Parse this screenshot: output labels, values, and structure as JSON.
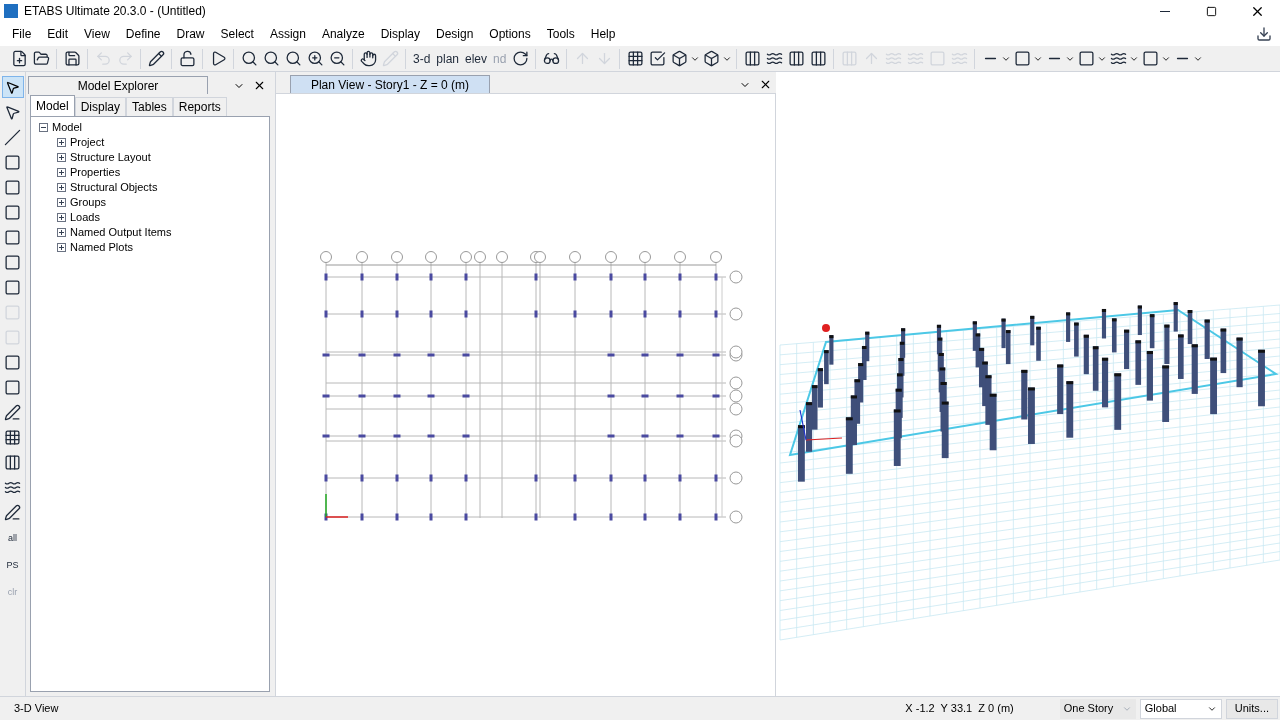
{
  "window": {
    "title": "ETABS Ultimate 20.3.0 - (Untitled)"
  },
  "menu": [
    "File",
    "Edit",
    "View",
    "Define",
    "Draw",
    "Select",
    "Assign",
    "Analyze",
    "Display",
    "Design",
    "Options",
    "Tools",
    "Help"
  ],
  "toolbar": {
    "text_buttons": [
      {
        "label": "3-d",
        "disabled": false
      },
      {
        "label": "plan",
        "disabled": false
      },
      {
        "label": "elev",
        "disabled": false
      },
      {
        "label": "nd",
        "disabled": true
      }
    ]
  },
  "left_tools": [
    {
      "label": "all",
      "disabled": false
    },
    {
      "label": "PS",
      "disabled": false
    },
    {
      "label": "clr",
      "disabled": true
    }
  ],
  "explorer": {
    "title": "Model Explorer",
    "tabs": [
      {
        "label": "Model",
        "selected": true
      },
      {
        "label": "Display",
        "selected": false
      },
      {
        "label": "Tables",
        "selected": false
      },
      {
        "label": "Reports",
        "selected": false
      }
    ],
    "tree": {
      "label": "Model",
      "expanded": true,
      "children": [
        {
          "label": "Project",
          "expanded": false
        },
        {
          "label": "Structure Layout",
          "expanded": false
        },
        {
          "label": "Properties",
          "expanded": false
        },
        {
          "label": "Structural Objects",
          "expanded": false
        },
        {
          "label": "Groups",
          "expanded": false
        },
        {
          "label": "Loads",
          "expanded": false
        },
        {
          "label": "Named Output Items",
          "expanded": false
        },
        {
          "label": "Named Plots",
          "expanded": false
        }
      ]
    }
  },
  "view_tab": {
    "title": "Plan View - Story1 - Z = 0 (m)"
  },
  "status_bar": {
    "view": "3-D View",
    "coordinates": "X -1.2  Y 33.1  Z 0 (m)",
    "story_select": {
      "value": "One Story",
      "disabled": true
    },
    "system_select": {
      "value": "Global",
      "disabled": false
    },
    "units_button": "Units..."
  }
}
